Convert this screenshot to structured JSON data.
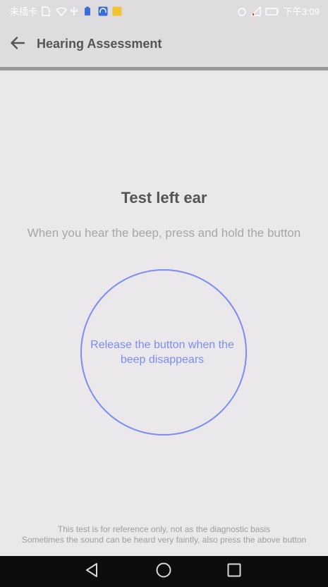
{
  "status_bar": {
    "carrier": "未插卡",
    "time": "下午3:09"
  },
  "app_bar": {
    "title": "Hearing Assessment",
    "back_icon": "arrow-left-icon"
  },
  "main": {
    "heading": "Test left ear",
    "instruction": "When you hear the beep, press and hold the button",
    "circle_button": {
      "label": "Release the button when the beep disappears",
      "color": "#7b8ef0"
    }
  },
  "footer": {
    "line1": "This test is for reference only, not as the diagnostic basis",
    "line2": "Sometimes the sound can be heard very faintly, also press the above button"
  },
  "nav_bar": {
    "icons": [
      "back-triangle-icon",
      "home-circle-icon",
      "recents-square-icon"
    ]
  }
}
